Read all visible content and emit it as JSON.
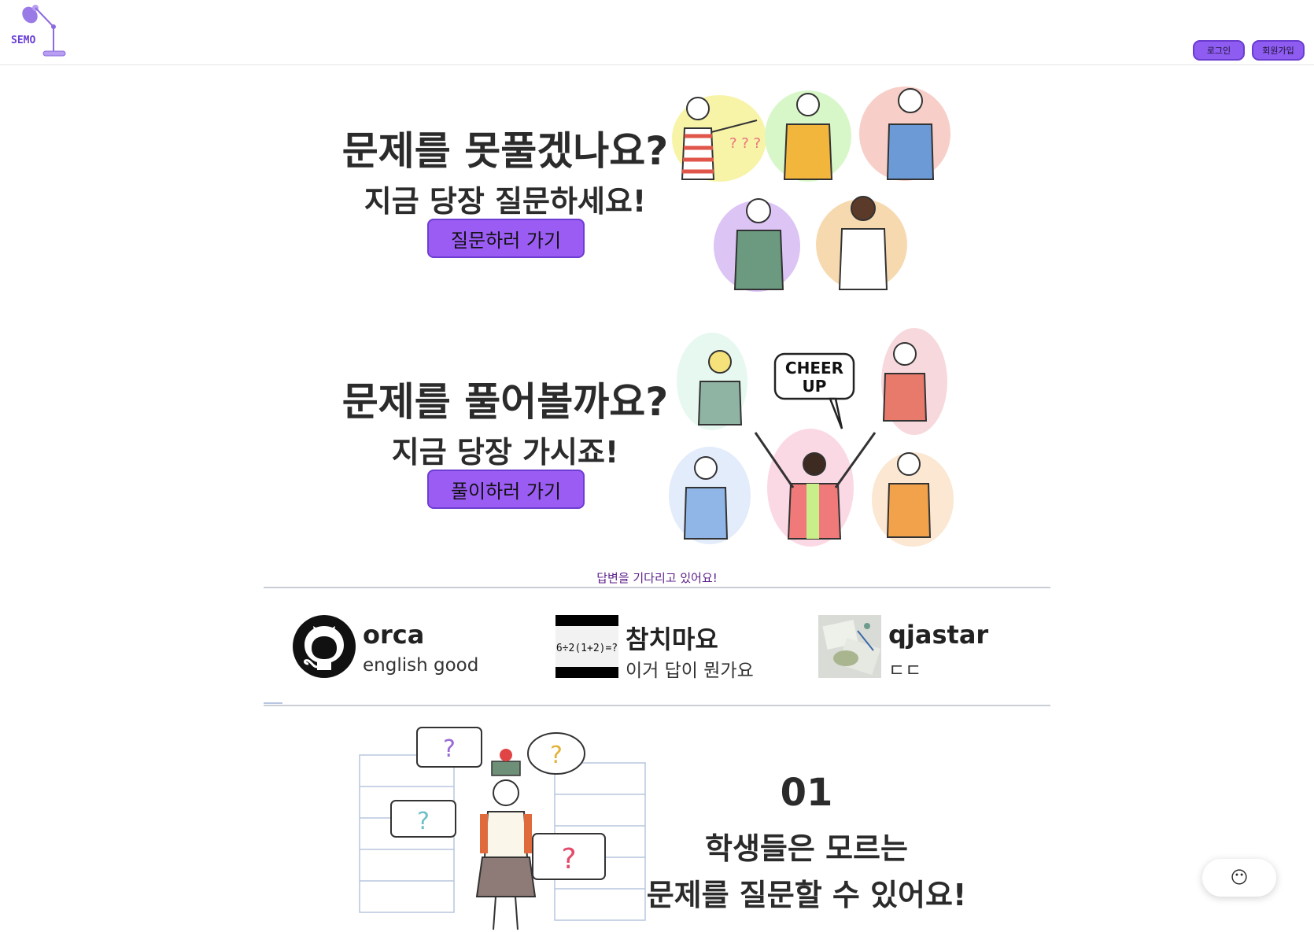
{
  "header": {
    "logo_text": "SEMO",
    "login_label": "로그인",
    "signup_label": "회원가입"
  },
  "hero_ask": {
    "title": "문제를 못풀겠나요?",
    "subtitle": "지금 당장 질문하세요!",
    "button_label": "질문하러 가기"
  },
  "hero_solve": {
    "title": "문제를 풀어볼까요?",
    "subtitle": "지금 당장 가시죠!",
    "button_label": "풀이하러 가기",
    "speech_bubble_line1": "CHEER",
    "speech_bubble_line2": "UP"
  },
  "waiting": {
    "label": "답변을 기다리고 있어요!",
    "questions": [
      {
        "name": "orca",
        "text": "english good",
        "thumb": "github-icon"
      },
      {
        "name": "참치마요",
        "text": "이거 답이 뭔가요",
        "thumb": "math-problem-image",
        "thumb_text": "6÷2(1+2)=?"
      },
      {
        "name": "qjastar",
        "text": "ㄷㄷ",
        "thumb": "study-desk-photo"
      }
    ]
  },
  "feature": {
    "number": "01",
    "line1": "학생들은 모르는",
    "line2": "문제를 질문할 수 있어요!"
  },
  "chat_fab": {
    "icon": "😶"
  },
  "colors": {
    "accent": "#9b5cf3",
    "accent_border": "#6e3dd1",
    "wait_label": "#5c1f8a"
  }
}
